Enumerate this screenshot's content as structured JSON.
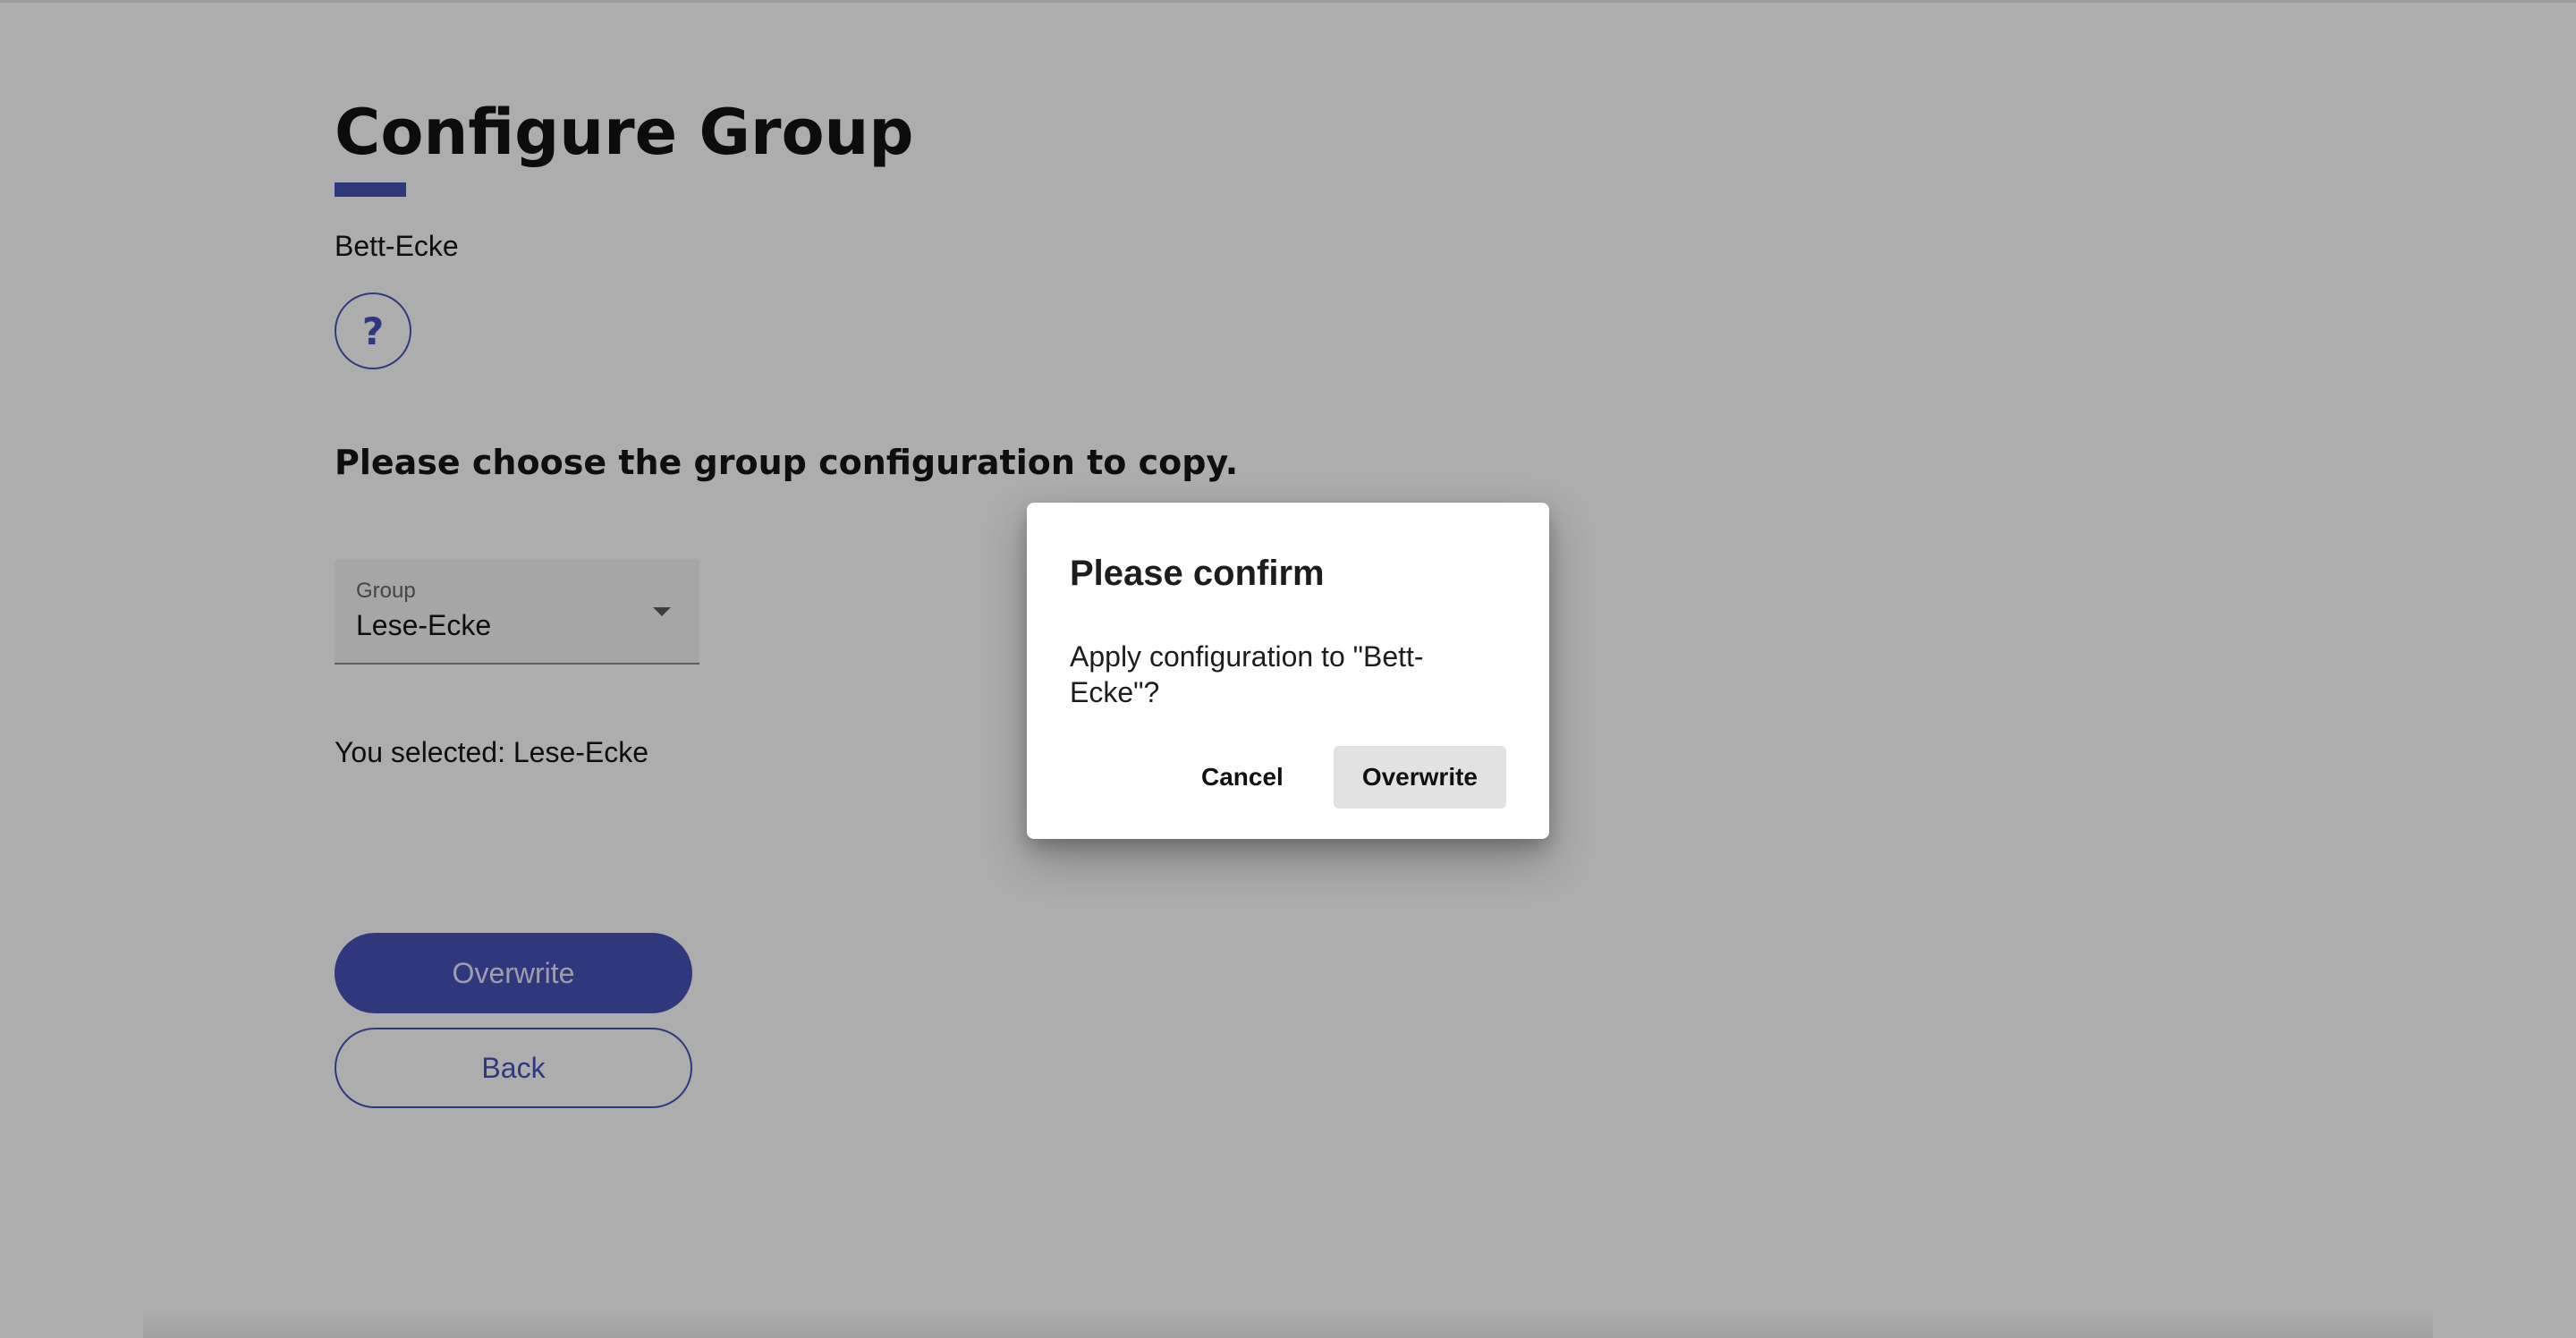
{
  "page": {
    "title": "Configure Group",
    "group_name": "Bett-Ecke",
    "help_icon": "?",
    "prompt": "Please choose the group configuration to copy.",
    "select": {
      "label": "Group",
      "value": "Lese-Ecke"
    },
    "selected_text": "You selected: Lese-Ecke",
    "overwrite_label": "Overwrite",
    "back_label": "Back"
  },
  "dialog": {
    "title": "Please confirm",
    "message": "Apply configuration to \"Bett-Ecke\"?",
    "cancel_label": "Cancel",
    "confirm_label": "Overwrite"
  },
  "colors": {
    "accent": "#4853b9",
    "scrim": "rgba(0,0,0,0.32)"
  },
  "icons": {
    "help": "help-icon",
    "dropdown": "chevron-down-icon"
  }
}
